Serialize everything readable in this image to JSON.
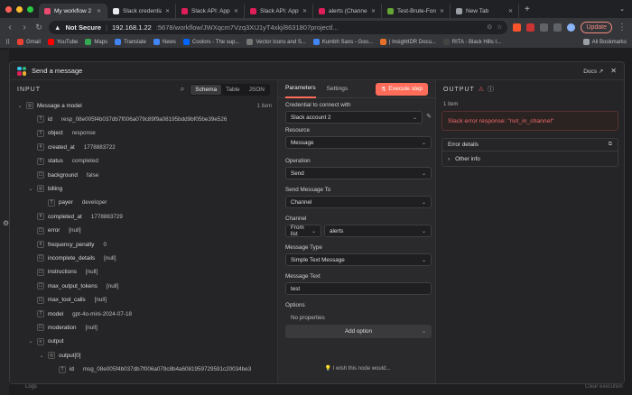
{
  "browser": {
    "tabs": [
      {
        "label": "My workflow 2 -",
        "color": "#ea4b71",
        "active": true
      },
      {
        "label": "Slack credentials | n8n",
        "color": "#e8eaed",
        "active": false
      },
      {
        "label": "Slack API: Applications",
        "color": "#e01e5a",
        "active": false
      },
      {
        "label": "Slack API: Applications",
        "color": "#e01e5a",
        "active": false
      },
      {
        "label": "alerts (Channel) - soc-",
        "color": "#e01e5a",
        "active": false
      },
      {
        "label": "Test-Brute-Force | Splu",
        "color": "#65a637",
        "active": false
      },
      {
        "label": "New Tab",
        "color": "#9aa0a6",
        "active": false
      }
    ],
    "new_tab": "+",
    "not_secure": "Not Secure",
    "url_host": "192.168.1.22",
    "url_path": ":5678/workflow/JWXqcm7Vzq3XIJ1yT4xkj/8631807projectl...",
    "update_label": "Update",
    "bookmarks": [
      {
        "label": "Gmail",
        "color": "#ea4335"
      },
      {
        "label": "YouTube",
        "color": "#ff0000"
      },
      {
        "label": "Maps",
        "color": "#34a853"
      },
      {
        "label": "Translate",
        "color": "#4285f4"
      },
      {
        "label": "News",
        "color": "#4285f4"
      },
      {
        "label": "Coolors - The sup...",
        "color": "#0066ff"
      },
      {
        "label": "Vector Icons and S...",
        "color": "#777777"
      },
      {
        "label": "Kumbh Sans - Goo...",
        "color": "#4285f4"
      },
      {
        "label": "| InsightIDR Docu...",
        "color": "#e8712a"
      },
      {
        "label": "RITA - Black Hills I...",
        "color": "#444444"
      }
    ],
    "all_bookmarks": "All Bookmarks"
  },
  "modal": {
    "title": "Send a message",
    "docs": "Docs"
  },
  "input": {
    "label": "INPUT",
    "view_tabs": [
      "Schema",
      "Table",
      "JSON"
    ],
    "active_view": "Schema",
    "item_count": "1 item",
    "rows": [
      {
        "indent": 0,
        "chev": "⌄",
        "type": "◎",
        "key": "Message a model",
        "value": ""
      },
      {
        "indent": 1,
        "chev": "",
        "type": "T",
        "key": "id",
        "value": "resp_08e005f4b037db7f006a079c89f9a08195bdd9bf05be39e526"
      },
      {
        "indent": 1,
        "chev": "",
        "type": "T",
        "key": "object",
        "value": "response"
      },
      {
        "indent": 1,
        "chev": "",
        "type": "#",
        "key": "created_at",
        "value": "1778883722"
      },
      {
        "indent": 1,
        "chev": "",
        "type": "T",
        "key": "status",
        "value": "completed"
      },
      {
        "indent": 1,
        "chev": "",
        "type": "☐",
        "key": "background",
        "value": "false"
      },
      {
        "indent": 1,
        "chev": "⌄",
        "type": "◎",
        "key": "billing",
        "value": ""
      },
      {
        "indent": 2,
        "chev": "",
        "type": "T",
        "key": "payer",
        "value": "developer"
      },
      {
        "indent": 1,
        "chev": "",
        "type": "#",
        "key": "completed_at",
        "value": "1778883729"
      },
      {
        "indent": 1,
        "chev": "",
        "type": "☐",
        "key": "error",
        "value": "[null]"
      },
      {
        "indent": 1,
        "chev": "",
        "type": "#",
        "key": "frequency_penalty",
        "value": "0"
      },
      {
        "indent": 1,
        "chev": "",
        "type": "☐",
        "key": "incomplete_details",
        "value": "[null]"
      },
      {
        "indent": 1,
        "chev": "",
        "type": "☐",
        "key": "instructions",
        "value": "[null]"
      },
      {
        "indent": 1,
        "chev": "",
        "type": "☐",
        "key": "max_output_tokens",
        "value": "[null]"
      },
      {
        "indent": 1,
        "chev": "",
        "type": "☐",
        "key": "max_tool_calls",
        "value": "[null]"
      },
      {
        "indent": 1,
        "chev": "",
        "type": "T",
        "key": "model",
        "value": "gpt-4o-mini-2024-07-18"
      },
      {
        "indent": 1,
        "chev": "",
        "type": "☐",
        "key": "moderation",
        "value": "[null]"
      },
      {
        "indent": 1,
        "chev": "⌄",
        "type": "≡",
        "key": "output",
        "value": ""
      },
      {
        "indent": 2,
        "chev": "⌄",
        "type": "◎",
        "key": "output[0]",
        "value": ""
      },
      {
        "indent": 3,
        "chev": "",
        "type": "T",
        "key": "id",
        "value": "msg_08e005f4b037db7f006a079c8b4a6081959729591c20034be3"
      }
    ]
  },
  "params": {
    "tabs": [
      "Parameters",
      "Settings"
    ],
    "execute_label": "Execute step",
    "credential_label": "Credential to connect with",
    "credential_value": "Slack account 2",
    "resource_label": "Resource",
    "resource_value": "Message",
    "operation_label": "Operation",
    "operation_value": "Send",
    "send_to_label": "Send Message To",
    "send_to_value": "Channel",
    "channel_label": "Channel",
    "channel_mode": "From list",
    "channel_value": "alerts",
    "msg_type_label": "Message Type",
    "msg_type_value": "Simple Text Message",
    "msg_text_label": "Message Text",
    "msg_text_value": "test",
    "options_label": "Options",
    "no_props": "No properties",
    "add_option": "Add option",
    "wish": "I wish this node would..."
  },
  "output": {
    "label": "OUTPUT",
    "item_count": "1 item",
    "error_text": "Slack error response: \"not_in_channel\"",
    "details_label": "Error details",
    "other_info": "Other info"
  },
  "footer": {
    "logs": "Logs",
    "clear": "Clear execution"
  }
}
